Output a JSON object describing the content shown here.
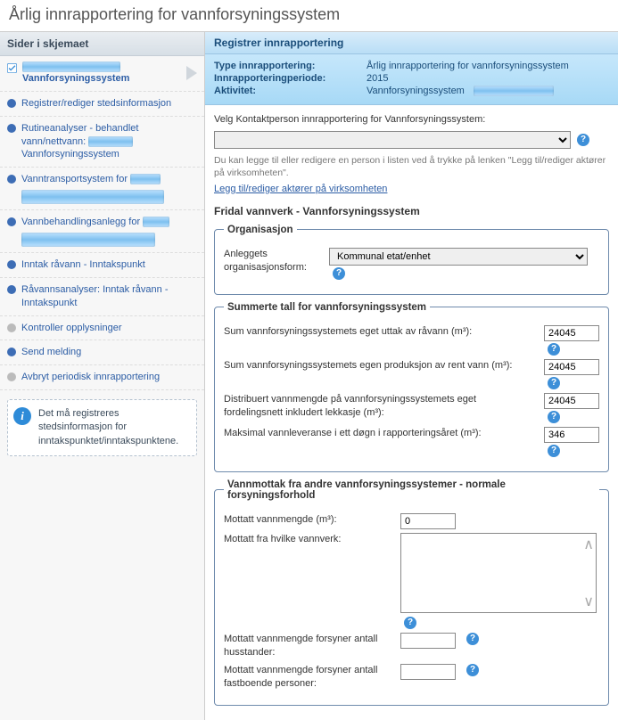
{
  "page_title": "Årlig innrapportering for vannforsyningssystem",
  "sidebar": {
    "header": "Sider i skjemaet",
    "items": [
      {
        "label": "Vannforsyningssystem",
        "check": true,
        "current": true
      },
      {
        "label": "Registrer/rediger stedsinformasjon"
      },
      {
        "label_pre": "Rutineanalyser - behandlet vann/nettvann: ",
        "label_post": " Vannforsyningssystem"
      },
      {
        "label_pre": "Vanntransportsystem for "
      },
      {
        "label_pre": "Vannbehandlingsanlegg for "
      },
      {
        "label": "Inntak råvann - Inntakspunkt"
      },
      {
        "label": "Råvannsanalyser: Inntak råvann - Inntakspunkt"
      },
      {
        "label": "Kontroller opplysninger",
        "grey": true
      },
      {
        "label": "Send melding"
      },
      {
        "label": "Avbryt periodisk innrapportering",
        "grey": true
      }
    ],
    "infobox": "Det må registreres stedsinformasjon for inntakspunktet/inntakspunktene."
  },
  "main": {
    "header": "Registrer innrapportering",
    "meta": {
      "type_label": "Type innrapportering:",
      "type_value": "Årlig innrapportering for vannforsyningssystem",
      "period_label": "Innrapporteringperiode:",
      "period_value": "2015",
      "activity_label": "Aktivitet:",
      "activity_value": "Vannforsyningssystem"
    },
    "contact_label": "Velg Kontaktperson innrapportering for Vannforsyningssystem:",
    "hint_text": "Du kan legge til eller redigere en person i listen ved å trykke på lenken \"Legg til/rediger aktører på virksomheten\".",
    "hint_link": "Legg til/rediger aktører på virksomheten",
    "sub_title": "Fridal vannverk - Vannforsyningssystem",
    "org": {
      "legend": "Organisasjon",
      "label": "Anleggets organisasjonsform:",
      "value": "Kommunal etat/enhet"
    },
    "sums": {
      "legend": "Summerte tall for vannforsyningssystem",
      "r1_label": "Sum vannforsyningssystemets eget uttak av råvann (m³):",
      "r1_value": "24045",
      "r2_label": "Sum vannforsyningssystemets egen produksjon av rent vann (m³):",
      "r2_value": "24045",
      "r3_label": "Distribuert vannmengde på vannforsyningssystemets eget fordelingsnett inkludert lekkasje (m³):",
      "r3_value": "24045",
      "r4_label": "Maksimal vannleveranse i ett døgn i rapporteringsåret (m³):",
      "r4_value": "346"
    },
    "intake": {
      "legend": "Vannmottak fra andre vannforsyningssystemer - normale forsyningsforhold",
      "r1_label": "Mottatt vannmengde (m³):",
      "r1_value": "0",
      "r2_label": "Mottatt fra hvilke vannverk:",
      "r3_label": "Mottatt vannmengde forsyner antall husstander:",
      "r4_label": "Mottatt vannmengde forsyner antall fastboende personer:"
    }
  }
}
